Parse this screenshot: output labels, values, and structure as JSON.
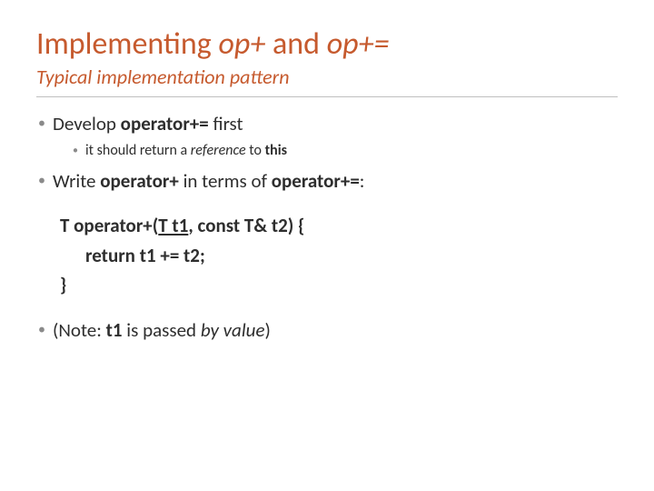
{
  "title": {
    "pre": "Implementing ",
    "em1": "op+",
    "mid": " and ",
    "em2": "op+="
  },
  "subtitle": "Typical implementation pattern",
  "bullets": {
    "b1_pre": "Develop ",
    "b1_b": "operator+=",
    "b1_post": " first",
    "b1a_pre": "it should return a ",
    "b1a_i": "reference",
    "b1a_mid": " to ",
    "b1a_b": "this",
    "b2_pre": "Write ",
    "b2_b1": "operator+",
    "b2_mid": " in terms of ",
    "b2_b2": "operator+=",
    "b2_post": ":",
    "b3_pre": "(Note: ",
    "b3_b": "t1",
    "b3_mid": " is passed ",
    "b3_i": "by value",
    "b3_post": ")"
  },
  "code": {
    "l1_pre": "T operator+(",
    "l1_u": "T t1",
    "l1_post": ", const T& t2) {",
    "l2": "return t1 += t2;",
    "l3": "}"
  }
}
